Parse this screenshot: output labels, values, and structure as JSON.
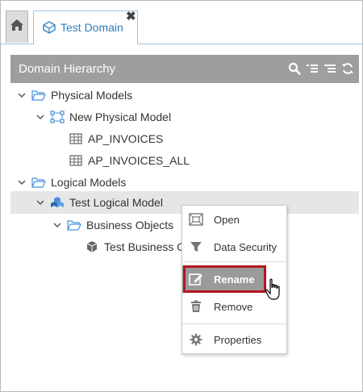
{
  "tabs": {
    "home_icon": "home-icon",
    "active_label": "Test Domain",
    "close_glyph": "✖"
  },
  "panel": {
    "title": "Domain Hierarchy",
    "tools": [
      "search-icon",
      "expand-all-icon",
      "collapse-all-icon",
      "refresh-icon"
    ]
  },
  "tree": {
    "physical_models": "Physical Models",
    "new_physical_model": "New Physical Model",
    "ap_invoices": "AP_INVOICES",
    "ap_invoices_all": "AP_INVOICES_ALL",
    "logical_models": "Logical Models",
    "test_logical_model": "Test Logical Model",
    "business_objects": "Business Objects",
    "test_business_object": "Test Business O"
  },
  "context_menu": {
    "open": "Open",
    "data_security": "Data Security",
    "rename": "Rename",
    "remove": "Remove",
    "properties": "Properties"
  },
  "colors": {
    "header_bg": "#9e9e9e",
    "tab_accent": "#2b7fc3",
    "folder_blue": "#4a90d9",
    "hover_bg": "#9a9a9a",
    "highlight_outline": "#b5151e"
  }
}
